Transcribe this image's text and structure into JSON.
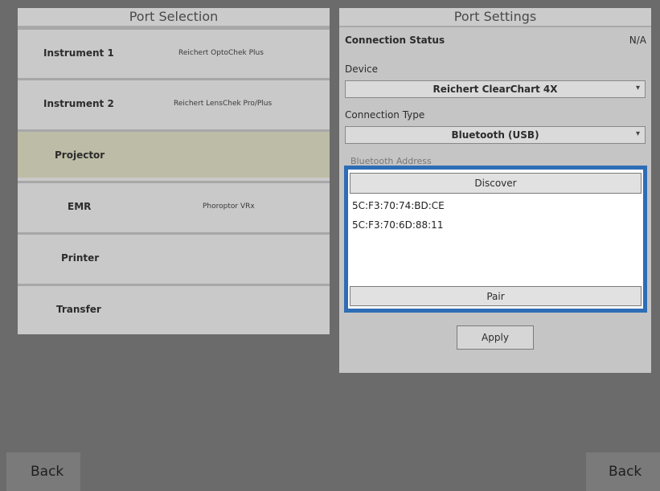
{
  "port_selection": {
    "title": "Port Selection",
    "rows": [
      {
        "name": "Instrument 1",
        "device": "Reichert OptoChek Plus",
        "selected": false
      },
      {
        "name": "Instrument 2",
        "device": "Reichert LensChek Pro/Plus",
        "selected": false
      },
      {
        "name": "Projector",
        "device": "",
        "selected": true
      },
      {
        "name": "EMR",
        "device": "Phoroptor VRx",
        "selected": false
      },
      {
        "name": "Printer",
        "device": "",
        "selected": false
      },
      {
        "name": "Transfer",
        "device": "",
        "selected": false
      }
    ]
  },
  "port_settings": {
    "title": "Port Settings",
    "connection_status_label": "Connection Status",
    "connection_status_value": "N/A",
    "device_label": "Device",
    "device_value": "Reichert ClearChart 4X",
    "connection_type_label": "Connection Type",
    "connection_type_value": "Bluetooth (USB)",
    "bluetooth_address_label": "Bluetooth Address",
    "discover_label": "Discover",
    "addresses": [
      "5C:F3:70:74:BD:CE",
      "5C:F3:70:6D:88:11"
    ],
    "pair_label": "Pair",
    "apply_label": "Apply"
  },
  "footer": {
    "back_left": "Back",
    "back_right": "Back"
  },
  "colors": {
    "highlight_border": "#2e6db6",
    "selected_row": "#bdbca6",
    "background": "#6b6b6b"
  },
  "icons": {
    "dropdown": "chevron-down-icon"
  }
}
